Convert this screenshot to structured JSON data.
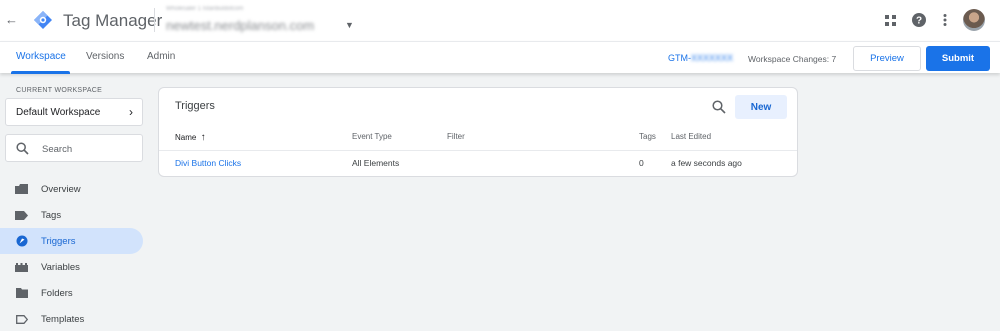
{
  "header": {
    "back_icon": "arrow-back-icon",
    "app_title": "Tag Manager",
    "account_name": "Wholesaler 1 Istanbuldotcom",
    "container_name": "newtest.nerdplanson.com",
    "icons": [
      "apps-icon",
      "help-icon",
      "more-vert-icon"
    ]
  },
  "nav": {
    "tabs": [
      {
        "label": "Workspace",
        "active": true
      },
      {
        "label": "Versions",
        "active": false
      },
      {
        "label": "Admin",
        "active": false
      }
    ],
    "gtm_prefix": "GTM-",
    "gtm_suffix": "XXXXXXX",
    "workspace_changes": "Workspace Changes: 7",
    "preview_label": "Preview",
    "submit_label": "Submit"
  },
  "sidebar": {
    "current_workspace_label": "CURRENT WORKSPACE",
    "workspace_name": "Default Workspace",
    "search_placeholder": "Search",
    "items": [
      {
        "label": "Overview",
        "icon": "overview-icon",
        "active": false
      },
      {
        "label": "Tags",
        "icon": "tag-icon",
        "active": false
      },
      {
        "label": "Triggers",
        "icon": "trigger-icon",
        "active": true
      },
      {
        "label": "Variables",
        "icon": "variables-icon",
        "active": false
      },
      {
        "label": "Folders",
        "icon": "folder-icon",
        "active": false
      },
      {
        "label": "Templates",
        "icon": "template-icon",
        "active": false
      }
    ]
  },
  "triggers": {
    "title": "Triggers",
    "new_label": "New",
    "columns": {
      "name": "Name",
      "event_type": "Event Type",
      "filter": "Filter",
      "tags": "Tags",
      "last_edited": "Last Edited"
    },
    "sort_icon": "arrow-upward-icon",
    "rows": [
      {
        "name": "Divi Button Clicks",
        "event_type": "All Elements",
        "filter": "",
        "tags": "0",
        "last_edited": "a few seconds ago"
      }
    ]
  },
  "colors": {
    "accent": "#1a73e8",
    "active_nav_bg": "#d2e3fc",
    "page_bg": "#f1f3f4"
  }
}
